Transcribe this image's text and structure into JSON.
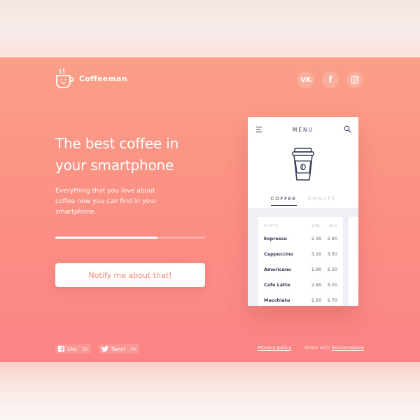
{
  "brand": {
    "name": "Coffeeman"
  },
  "socials": [
    {
      "name": "vk",
      "glyph": "VK"
    },
    {
      "name": "facebook",
      "glyph": "f"
    },
    {
      "name": "instagram",
      "glyph": ""
    }
  ],
  "hero": {
    "title_line1": "The best coffee in",
    "title_line2": "your smartphone",
    "description": "Everything that you love about coffee now you can find in your smartphone.",
    "progress": 0.68,
    "cta_label": "Notify me about that!"
  },
  "phone": {
    "menu_title": "MENU",
    "tabs": [
      "COFFEE",
      "DONUTS"
    ],
    "active_tab": "COFFEE",
    "table_headers": [
      "SHOTS",
      "SML",
      "LRG"
    ],
    "items": [
      {
        "name": "Expresso",
        "sml": "2.30",
        "lrg": "2.90"
      },
      {
        "name": "Cappuccino",
        "sml": "3.10",
        "lrg": "3.50"
      },
      {
        "name": "Americano",
        "sml": "1.90",
        "lrg": "2.20"
      },
      {
        "name": "Cafe Latte",
        "sml": "2.60",
        "lrg": "3.00"
      },
      {
        "name": "Macchiato",
        "sml": "2.20",
        "lrg": "2.70"
      }
    ]
  },
  "footer": {
    "like_label": "Like",
    "like_count": "2K",
    "tweet_label": "Tweet",
    "tweet_count": "4K",
    "privacy_label": "Privacy policy",
    "made_with_label": "Made with",
    "made_with_link": "Sovsemskoro"
  },
  "colors": {
    "gradient_top": "#fb9f87",
    "gradient_bottom": "#fb8485",
    "cta_text": "#f08a74",
    "phone_text": "#343a57"
  }
}
